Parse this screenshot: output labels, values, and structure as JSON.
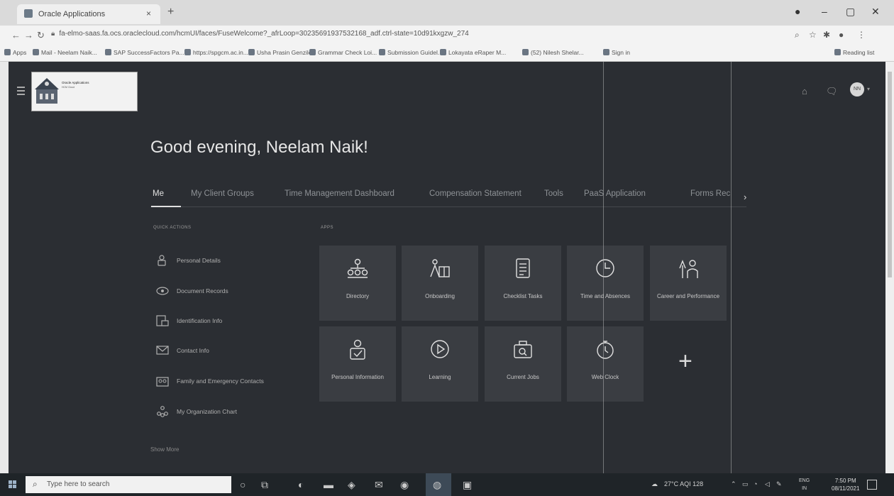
{
  "browser": {
    "tab_title": "Oracle Applications",
    "tab_close": "×",
    "new_tab": "+",
    "url": "fa-elmo-saas.fa.ocs.oraclecloud.com/hcmUI/faces/FuseWelcome?_afrLoop=30235691937532168_adf.ctrl-state=10d91kxgzw_274",
    "bookmarks": [
      "Apps",
      "Mail - Neelam Naik...",
      "SAP SuccessFactors Pa...",
      "https://spgcm.ac.in...",
      "Usha Prasin Genzile",
      "Grammar Check Loi...",
      "Submission Guidel...",
      "Lokayata eRaper M...",
      "(52) Nilesh Shelar...",
      "Sign in"
    ],
    "reading_list": "Reading list"
  },
  "header": {
    "logo_line1": "Oracle Applications",
    "logo_line2": "HCM Cloud",
    "avatar_initials": "NN"
  },
  "main": {
    "greeting": "Good evening, Neelam Naik!",
    "tabs": [
      "Me",
      "My Client Groups",
      "Time Management Dashboard",
      "Compensation Statement",
      "Tools",
      "PaaS Application",
      "Forms Rec"
    ],
    "quick_actions_label": "QUICK ACTIONS",
    "apps_label": "APPS",
    "quick_actions": [
      {
        "label": "Personal Details",
        "icon": "person-lock-icon"
      },
      {
        "label": "Document Records",
        "icon": "document-eye-icon"
      },
      {
        "label": "Identification Info",
        "icon": "id-card-icon"
      },
      {
        "label": "Contact Info",
        "icon": "envelope-icon"
      },
      {
        "label": "Family and Emergency Contacts",
        "icon": "family-icon"
      },
      {
        "label": "My Organization Chart",
        "icon": "org-chart-icon"
      }
    ],
    "show_more": "Show More",
    "apps": [
      {
        "label": "Directory",
        "icon": "directory-icon"
      },
      {
        "label": "Onboarding",
        "icon": "onboarding-icon"
      },
      {
        "label": "Checklist Tasks",
        "icon": "checklist-icon"
      },
      {
        "label": "Time and Absences",
        "icon": "clock-icon"
      },
      {
        "label": "Career and Performance",
        "icon": "career-icon"
      },
      {
        "label": "Personal Information",
        "icon": "personal-info-icon"
      },
      {
        "label": "Learning",
        "icon": "play-icon"
      },
      {
        "label": "Current Jobs",
        "icon": "jobs-icon"
      },
      {
        "label": "Web Clock",
        "icon": "stopwatch-icon"
      }
    ]
  },
  "taskbar": {
    "search_placeholder": "Type here to search",
    "weather": "27°C  AQI 128",
    "lang1": "ENG",
    "lang2": "IN",
    "time": "7:50 PM",
    "date": "08/11/2021"
  },
  "colors": {
    "app_bg": "#2b2e33",
    "tile_bg": "#3a3d42",
    "taskbar_bg": "#1f2428"
  }
}
